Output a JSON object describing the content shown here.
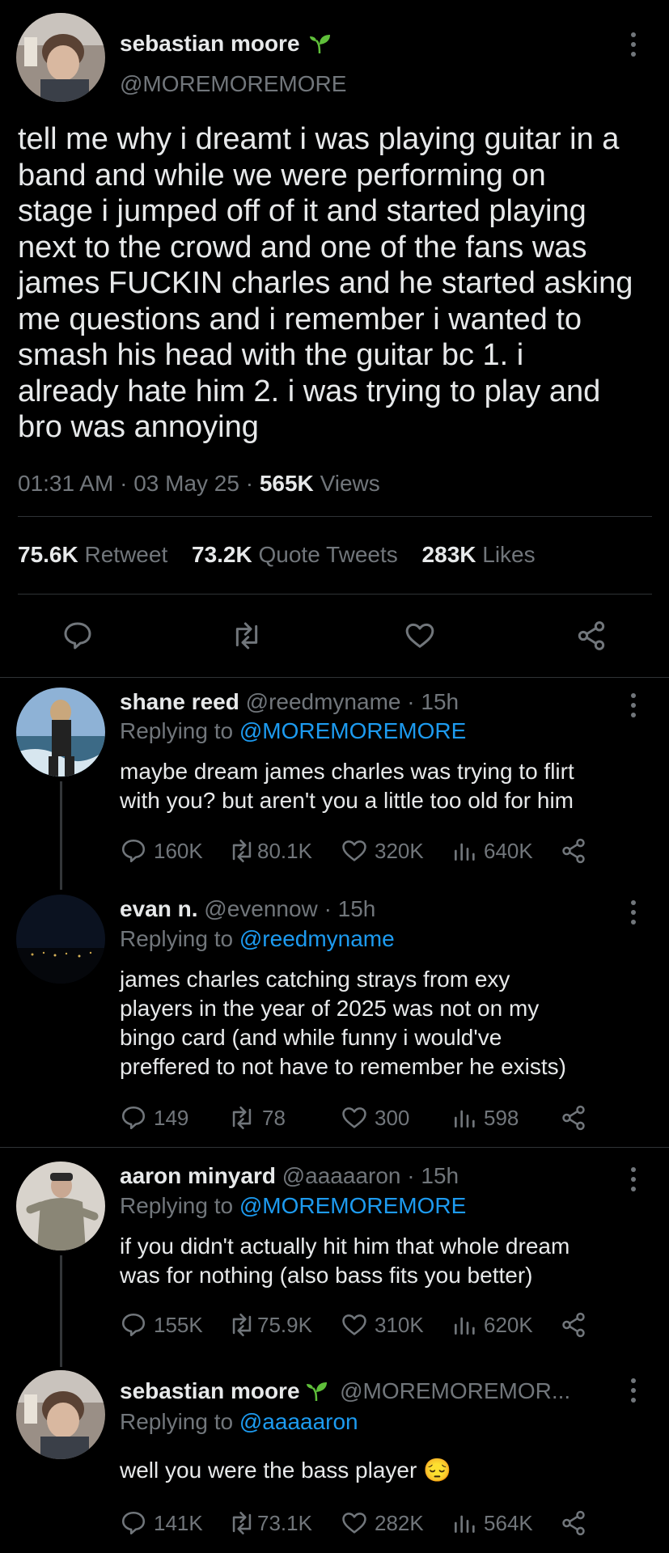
{
  "main_tweet": {
    "author_name": "sebastian moore",
    "author_handle": "@MOREMOREMORE",
    "text_lines": [
      "tell me why i dreamt i was playing guitar in a",
      "band and while we were performing on",
      "stage i jumped off of it and started playing",
      "next to the crowd and one of the fans was",
      "james FUCKIN charles and he started asking",
      "me questions and i remember i wanted to",
      "smash his head with the guitar bc 1. i",
      "already hate him 2. i was trying to play and",
      "bro was annoying"
    ],
    "time": "01:31 AM",
    "sep": "·",
    "date": "03 May 25",
    "views_count": "565K",
    "views_label": "Views",
    "retweets_count": "75.6K",
    "retweets_label": "Retweet",
    "quotes_count": "73.2K",
    "quotes_label": "Quote Tweets",
    "likes_count": "283K",
    "likes_label": "Likes"
  },
  "replies": [
    {
      "name": "shane reed",
      "handle": "@reedmyname",
      "time": "· 15h",
      "replying_to_label": "Replying to",
      "replying_to": "@MOREMOREMORE",
      "lines": [
        "maybe dream james charles was trying to flirt",
        "with you? but aren't you a little too old for him"
      ],
      "replies": "160K",
      "retweets": "80.1K",
      "likes": "320K",
      "views": "640K"
    },
    {
      "name": "evan n.",
      "handle": "@evennow",
      "time": "· 15h",
      "replying_to_label": "Replying to",
      "replying_to": "@reedmyname",
      "lines": [
        "james charles catching strays from exy",
        "players in the year of 2025 was not on my",
        "bingo card (and while funny i would've",
        "preffered to not have to remember he exists)"
      ],
      "replies": "149",
      "retweets": "78",
      "likes": "300",
      "views": "598"
    },
    {
      "name": "aaron minyard",
      "handle": "@aaaaaron",
      "time": "· 15h",
      "replying_to_label": "Replying to",
      "replying_to": "@MOREMOREMORE",
      "lines": [
        "if you didn't actually hit him that whole dream",
        "was for nothing (also bass fits you better)"
      ],
      "replies": "155K",
      "retweets": "75.9K",
      "likes": "310K",
      "views": "620K"
    },
    {
      "name": "sebastian moore",
      "handle": "@MOREMOREMOR...",
      "time": "",
      "replying_to_label": "Replying to",
      "replying_to": "@aaaaaron",
      "lines": [
        "well you were the bass player 😔"
      ],
      "replies": "141K",
      "retweets": "73.1K",
      "likes": "282K",
      "views": "564K"
    }
  ],
  "icons": {
    "verified_badge": "seedling-icon",
    "more": "more-vertical-icon",
    "reply": "comment-bubble-icon",
    "retweet": "retweet-icon",
    "like": "heart-icon",
    "views": "bar-chart-icon",
    "share": "share-nodes-icon"
  },
  "colors": {
    "background": "#000000",
    "text": "#e7e9ea",
    "muted": "#71767b",
    "link": "#1d9bf0",
    "badge": "#5fbf3a"
  }
}
